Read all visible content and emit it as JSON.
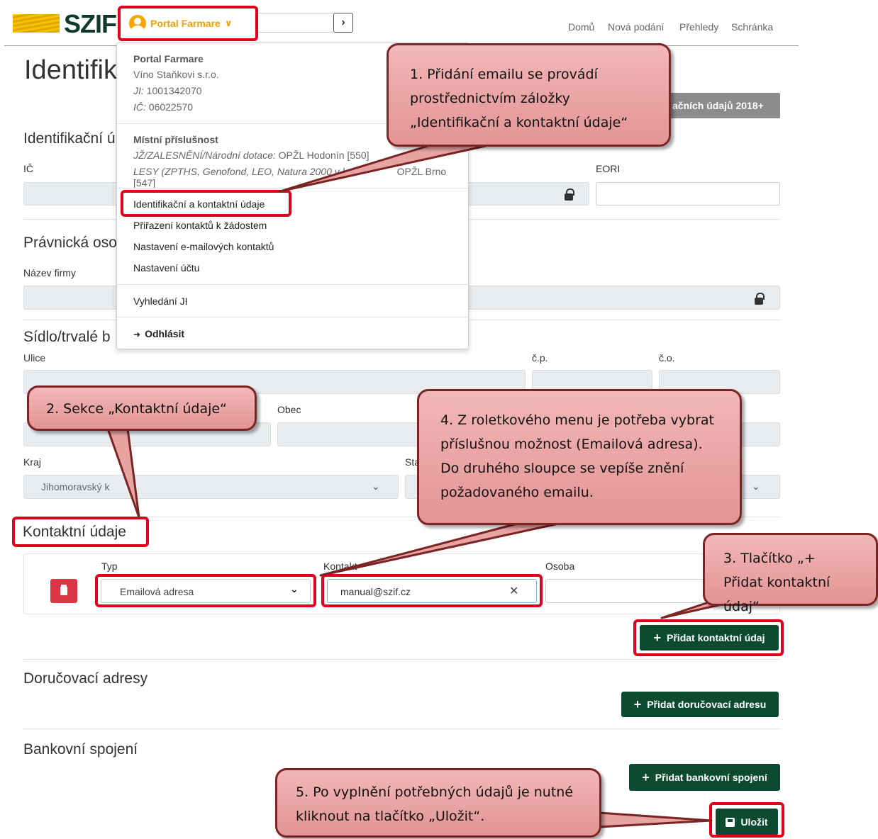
{
  "header": {
    "logo_text": "SZIF",
    "portal_label": "Portal Farmare",
    "nav": [
      "Domů",
      "Nová podání",
      "Přehledy",
      "Schránka"
    ]
  },
  "menu": {
    "portal_title": "Portal Farmare",
    "company": "Víno Staňkovi s.r.o.",
    "ji_label": "JI:",
    "ji_value": "1001342070",
    "ic_label": "IČ:",
    "ic_value": "06022570",
    "jurisdiction_title": "Místní příslušnost",
    "jur1_italic": "JŽ/ZALESNĚNÍ/Národní dotace:",
    "jur1_value": "OPŽL Hodonín [550]",
    "jur2_italic": "LESY (ZPTHS, Genofond, LEO, Natura 2000 v l",
    "jur2_value": "OPŽL Brno [547]",
    "items": [
      "Identifikační a kontaktní údaje",
      "Přiřazení kontaktů k žádostem",
      "Nastavení e-mailových kontaktů",
      "Nastavení účtu"
    ],
    "search_ji": "Vyhledání JI",
    "logout": "Odhlásit"
  },
  "page": {
    "title_visible": "Identifik",
    "btn_gray_label": "ačních údajů 2018+",
    "sec_ident": "Identifikační ú",
    "lbl_ic": "IČ",
    "lbl_eori": "EORI",
    "sec_pravnicka": "Právnická oso",
    "lbl_nazev": "Název firmy",
    "sec_sidlo": "Sídlo/trvalé b",
    "lbl_ulice": "Ulice",
    "lbl_cp": "č.p.",
    "lbl_co": "č.o.",
    "lbl_obec": "Obec",
    "lbl_kraj": "Kraj",
    "kraj_value": "Jihomoravský k",
    "lbl_stat": "Sta",
    "sec_kontakt": "Kontaktní údaje",
    "col_typ": "Typ",
    "col_kontakt": "Kontakt",
    "col_osoba": "Osoba",
    "typ_value": "Emailová adresa",
    "kontakt_value": "manual@szif.cz",
    "btn_add_contact": "Přidat kontaktní údaj",
    "sec_dorucovaci": "Doručovací adresy",
    "btn_add_delivery": "Přidat doručovací adresu",
    "sec_bank": "Bankovní spojení",
    "btn_add_bank": "Přidat bankovní spojení",
    "btn_save": "Uložit"
  },
  "callouts": {
    "c1": "1. Přidání emailu se provádí prostřednictvím záložky „Identifikační a kontaktní údaje“",
    "c2": "2. Sekce „Kontaktní údaje“",
    "c3": "3. Tlačítko „+ Přidat kontaktní údaj“",
    "c4": "4. Z roletkového menu je potřeba vybrat příslušnou možnost (Emailová adresa). Do druhého sloupce se vepíše znění požadovaného emailu.",
    "c5": "5. Po vyplnění potřebných údajů je nutné kliknout na tlačítko „Uložit“."
  }
}
